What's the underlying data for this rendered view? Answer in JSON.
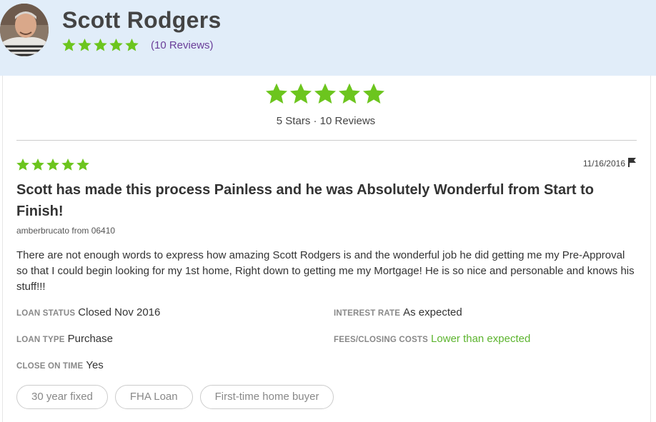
{
  "profile": {
    "name": "Scott Rodgers",
    "rating_stars": 5,
    "reviews_link": "(10 Reviews)"
  },
  "summary": {
    "stars": 5,
    "text": "5 Stars · 10 Reviews"
  },
  "review": {
    "stars": 5,
    "date": "11/16/2016",
    "title": "Scott has made this process Painless and he was Absolutely Wonderful from Start to Finish!",
    "reviewer": "amberbrucato from 06410",
    "body": "There are not enough words to express how amazing Scott Rodgers is and the wonderful job he did getting me my Pre-Approval so that I could begin looking for my 1st home, Right down to getting me my Mortgage! He is so nice and personable and knows his stuff!!!",
    "details": {
      "loan_status_label": "LOAN STATUS",
      "loan_status_value": "Closed Nov 2016",
      "interest_rate_label": "INTEREST RATE",
      "interest_rate_value": "As expected",
      "loan_type_label": "LOAN TYPE",
      "loan_type_value": "Purchase",
      "fees_label": "FEES/CLOSING COSTS",
      "fees_value": "Lower than expected",
      "close_on_time_label": "CLOSE ON TIME",
      "close_on_time_value": "Yes"
    },
    "tags": [
      "30 year fixed",
      "FHA Loan",
      "First-time home buyer"
    ]
  },
  "colors": {
    "star": "#6cc51e",
    "header_bg": "#e1edf9",
    "link": "#6a3e99",
    "positive": "#5cb42e"
  },
  "icons": {
    "star": "star-icon",
    "flag": "flag-icon"
  }
}
